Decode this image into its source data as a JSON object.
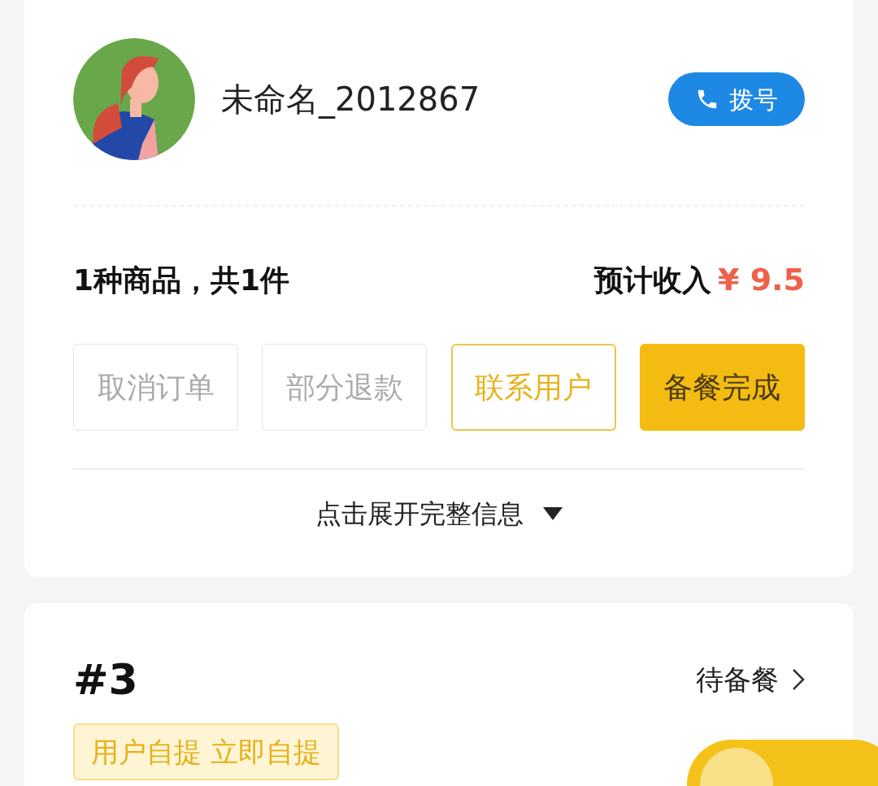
{
  "customer": {
    "name": "未命名_2012867",
    "dial_button": "拨号"
  },
  "summary": {
    "items": "1种商品，共1件",
    "income_label": "预计收入",
    "income_value": "¥ 9.5"
  },
  "actions": [
    {
      "label": "取消订单",
      "kind": "plain"
    },
    {
      "label": "部分退款",
      "kind": "plain"
    },
    {
      "label": "联系用户",
      "kind": "outline"
    },
    {
      "label": "备餐完成",
      "kind": "filled"
    }
  ],
  "expand": {
    "label": "点击展开完整信息",
    "expanded": false
  },
  "next_order": {
    "number": "#3",
    "status": "待备餐",
    "tags": [
      "用户自提 立即自提"
    ]
  }
}
